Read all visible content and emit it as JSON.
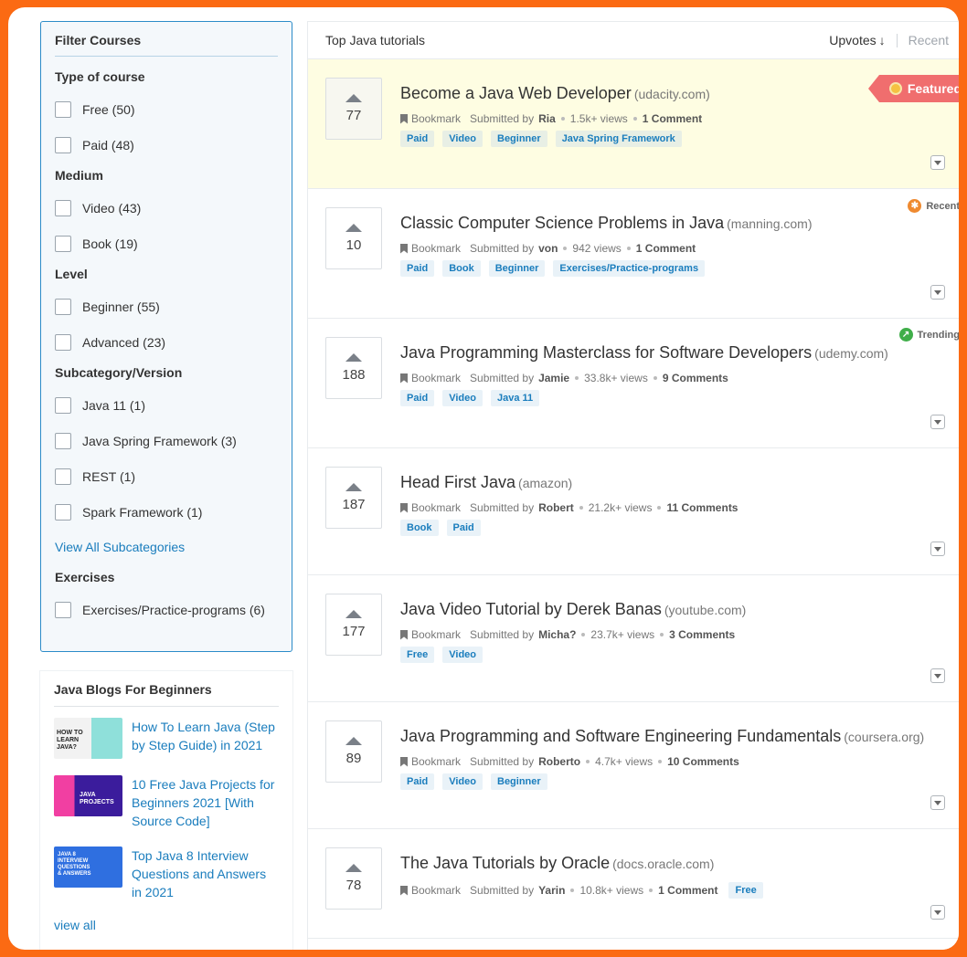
{
  "filter": {
    "title": "Filter Courses",
    "groups": [
      {
        "title": "Type of course",
        "options": [
          "Free (50)",
          "Paid (48)"
        ]
      },
      {
        "title": "Medium",
        "options": [
          "Video (43)",
          "Book (19)"
        ]
      },
      {
        "title": "Level",
        "options": [
          "Beginner (55)",
          "Advanced (23)"
        ]
      },
      {
        "title": "Subcategory/Version",
        "options": [
          "Java 11 (1)",
          "Java Spring Framework (3)",
          "REST (1)",
          "Spark Framework (1)"
        ]
      },
      {
        "title": "Exercises",
        "options": [
          "Exercises/Practice-programs (6)"
        ]
      }
    ],
    "view_all_subcategories": "View All Subcategories"
  },
  "blogs": {
    "title": "Java Blogs For Beginners",
    "items": [
      {
        "title": "How To Learn Java (Step by Step Guide) in 2021",
        "thumb_text": "HOW TO LEARN JAVA?"
      },
      {
        "title": "10 Free Java Projects for Beginners 2021 [With Source Code]",
        "thumb_text": "JAVA PROJECTS"
      },
      {
        "title": "Top Java 8 Interview Questions and Answers in 2021",
        "thumb_text": "JAVA 8 INTERVIEW QUESTIONS & ANSWERS"
      }
    ],
    "view_all": "view all"
  },
  "list": {
    "title": "Top Java tutorials",
    "sort_upvotes": "Upvotes",
    "sort_arrow": "↓",
    "sort_recent": "Recent",
    "bookmark_label": "Bookmark",
    "submitted_by": "Submitted by",
    "badges": {
      "featured": "Featured",
      "recent": "Recent",
      "trending": "Trending"
    },
    "items": [
      {
        "votes": "77",
        "title": "Become a Java Web Developer",
        "source": "(udacity.com)",
        "user": "Ria",
        "views": "1.5k+ views",
        "comments": "1 Comment",
        "tags": [
          "Paid",
          "Video",
          "Beginner",
          "Java Spring Framework"
        ]
      },
      {
        "votes": "10",
        "title": "Classic Computer Science Problems in Java",
        "source": "(manning.com)",
        "user": "von",
        "views": "942 views",
        "comments": "1 Comment",
        "tags": [
          "Paid",
          "Book",
          "Beginner",
          "Exercises/Practice-programs"
        ]
      },
      {
        "votes": "188",
        "title": "Java Programming Masterclass for Software Developers",
        "source": "(udemy.com)",
        "user": "Jamie",
        "views": "33.8k+ views",
        "comments": "9 Comments",
        "tags": [
          "Paid",
          "Video",
          "Java 11"
        ]
      },
      {
        "votes": "187",
        "title": "Head First Java",
        "source": "(amazon)",
        "user": "Robert",
        "views": "21.2k+ views",
        "comments": "11 Comments",
        "tags": [
          "Book",
          "Paid"
        ]
      },
      {
        "votes": "177",
        "title": "Java Video Tutorial by Derek Banas",
        "source": "(youtube.com)",
        "user": "Micha?",
        "views": "23.7k+ views",
        "comments": "3 Comments",
        "tags": [
          "Free",
          "Video"
        ]
      },
      {
        "votes": "89",
        "title": "Java Programming and Software Engineering Fundamentals",
        "source": "(coursera.org)",
        "user": "Roberto",
        "views": "4.7k+ views",
        "comments": "10 Comments",
        "tags": [
          "Paid",
          "Video",
          "Beginner"
        ]
      },
      {
        "votes": "78",
        "title": "The Java Tutorials by Oracle",
        "source": "(docs.oracle.com)",
        "user": "Yarin",
        "views": "10.8k+ views",
        "comments": "1 Comment",
        "tags": [
          "Free"
        ]
      }
    ]
  },
  "colors": {
    "accent": "#fb6a13",
    "link": "#1a7dbd",
    "featured_bg": "#fefde2",
    "featured_badge": "#f06e6e"
  }
}
